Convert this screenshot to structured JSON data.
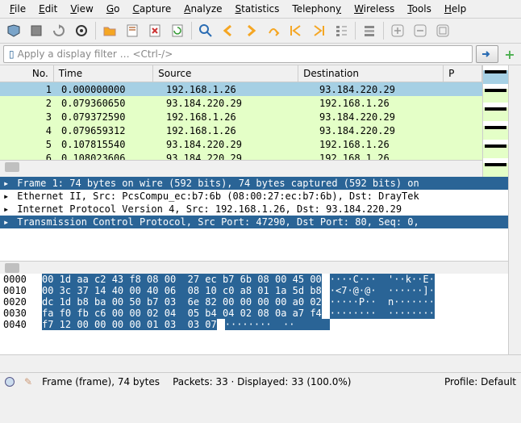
{
  "menu": {
    "file": "File",
    "edit": "Edit",
    "view": "View",
    "go": "Go",
    "capture": "Capture",
    "analyze": "Analyze",
    "statistics": "Statistics",
    "telephony": "Telephony",
    "wireless": "Wireless",
    "tools": "Tools",
    "help": "Help"
  },
  "filter": {
    "placeholder": "Apply a display filter … <Ctrl-/>"
  },
  "columns": {
    "no": "No.",
    "time": "Time",
    "source": "Source",
    "destination": "Destination",
    "protocol": "P"
  },
  "packets": [
    {
      "no": "1",
      "time": "0.000000000",
      "src": "192.168.1.26",
      "dst": "93.184.220.29",
      "sel": true
    },
    {
      "no": "2",
      "time": "0.079360650",
      "src": "93.184.220.29",
      "dst": "192.168.1.26",
      "green": true
    },
    {
      "no": "3",
      "time": "0.079372590",
      "src": "192.168.1.26",
      "dst": "93.184.220.29",
      "green": true
    },
    {
      "no": "4",
      "time": "0.079659312",
      "src": "192.168.1.26",
      "dst": "93.184.220.29",
      "green": true
    },
    {
      "no": "5",
      "time": "0.107815540",
      "src": "93.184.220.29",
      "dst": "192.168.1.26",
      "green": true
    },
    {
      "no": "6",
      "time": "0.108023606",
      "src": "93.184.220.29",
      "dst": "192.168.1.26",
      "green": true
    }
  ],
  "details": [
    {
      "text": "Frame 1: 74 bytes on wire (592 bits), 74 bytes captured (592 bits) on",
      "sel": true,
      "exp": true
    },
    {
      "text": "Ethernet II, Src: PcsCompu_ec:b7:6b (08:00:27:ec:b7:6b), Dst: DrayTek",
      "exp": true
    },
    {
      "text": "Internet Protocol Version 4, Src: 192.168.1.26, Dst: 93.184.220.29",
      "exp": true
    },
    {
      "text": "Transmission Control Protocol, Src Port: 47290, Dst Port: 80, Seq: 0,",
      "sel": true,
      "exp": true
    }
  ],
  "hex": [
    {
      "off": "0000",
      "b": "00 1d aa c2 43 f8 08 00  27 ec b7 6b 08 00 45 00",
      "a": "····C···  '··k··E·"
    },
    {
      "off": "0010",
      "b": "00 3c 37 14 40 00 40 06  08 10 c0 a8 01 1a 5d b8",
      "a": "·<7·@·@·  ······]·"
    },
    {
      "off": "0020",
      "b": "dc 1d b8 ba 00 50 b7 03  6e 82 00 00 00 00 a0 02",
      "a": "·····P··  n·······"
    },
    {
      "off": "0030",
      "b": "fa f0 fb c6 00 00 02 04  05 b4 04 02 08 0a a7 f4",
      "a": "········  ········"
    },
    {
      "off": "0040",
      "b": "f7 12 00 00 00 00 01 03  03 07",
      "a": "········  ··      "
    }
  ],
  "status": {
    "frame": "Frame (frame), 74 bytes",
    "packets": "Packets: 33 · Displayed: 33 (100.0%)",
    "profile": "Profile: Default"
  }
}
